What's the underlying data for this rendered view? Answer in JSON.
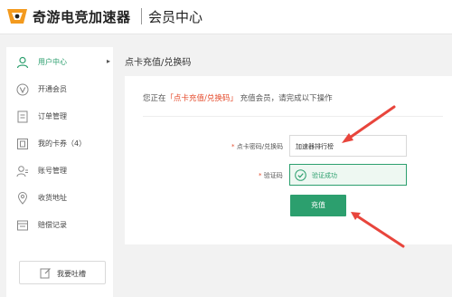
{
  "header": {
    "brand": "奇游电竞加速器",
    "title": "会员中心"
  },
  "sidebar": {
    "items": [
      {
        "label": "用户中心",
        "icon": "user-icon",
        "active": true
      },
      {
        "label": "开通会员",
        "icon": "vip-icon"
      },
      {
        "label": "订单管理",
        "icon": "document-icon"
      },
      {
        "label": "我的卡券（4）",
        "icon": "coupon-icon"
      },
      {
        "label": "账号管理",
        "icon": "account-icon"
      },
      {
        "label": "收货地址",
        "icon": "location-icon"
      },
      {
        "label": "赔偿记录",
        "icon": "compensation-icon"
      }
    ],
    "arrow": "▸",
    "feedback_label": "我要吐槽"
  },
  "main": {
    "title": "点卡充值/兑换码",
    "notice_prefix": "您正在",
    "notice_highlight": "「点卡充值/兑换码」",
    "notice_suffix": "充值会员，请完成以下操作",
    "code_label": "点卡密码/兑换码",
    "code_value": "加速器排行榜",
    "verify_label": "验证码",
    "verify_status": "验证成功",
    "submit_label": "充值"
  },
  "colors": {
    "accent": "#2c9f6e",
    "highlight": "#e54d2e",
    "annotation_arrow": "#e8453c"
  }
}
